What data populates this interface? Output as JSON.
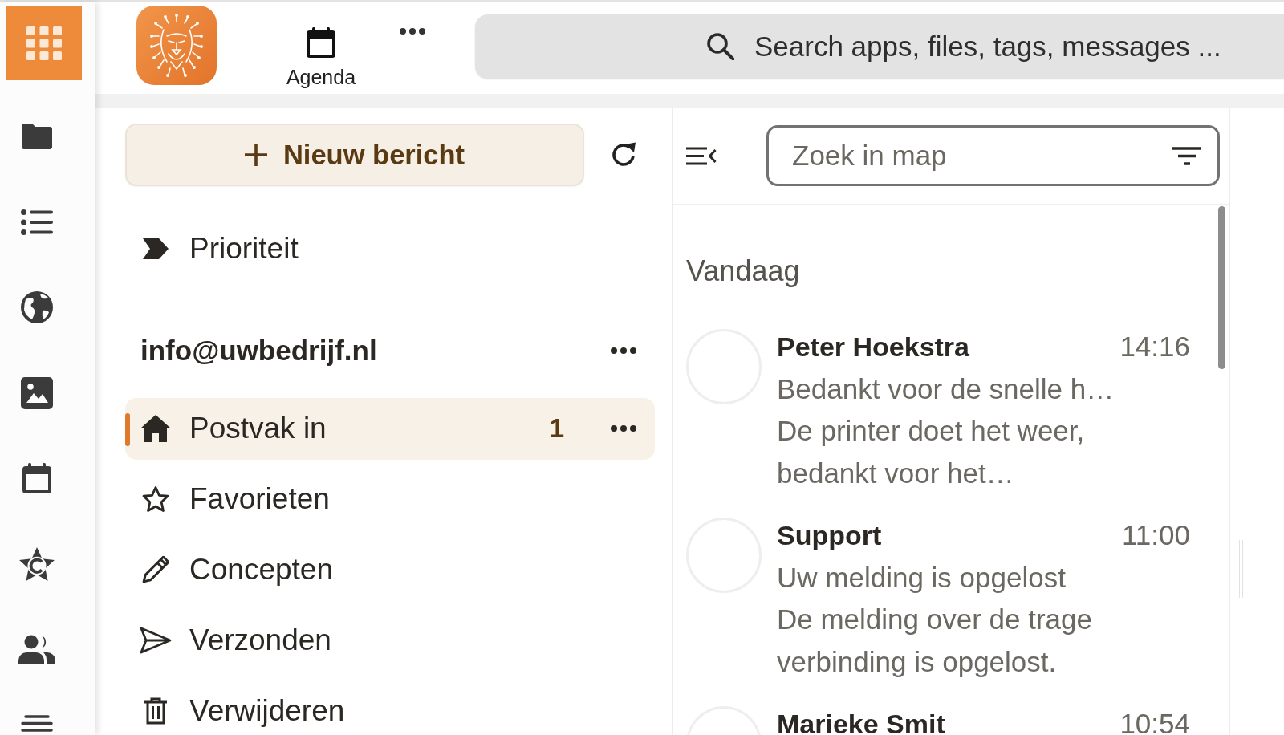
{
  "top_bar": {
    "apps": [
      {
        "label": "Agenda",
        "kind": "calendar"
      }
    ],
    "search": {
      "placeholder": "Search apps, files, tags, messages ..."
    }
  },
  "folder_panel": {
    "new_message_button": "Nieuw bericht",
    "smart_folders": [
      {
        "label": "Prioriteit",
        "kind": "priority",
        "selected": false
      }
    ],
    "account": {
      "email": "info@uwbedrijf.nl",
      "folders": [
        {
          "label": "Postvak in",
          "kind": "inbox",
          "selected": true,
          "unread_count": "1"
        },
        {
          "label": "Favorieten",
          "kind": "starred",
          "selected": false
        },
        {
          "label": "Concepten",
          "kind": "drafts",
          "selected": false
        },
        {
          "label": "Verzonden",
          "kind": "sent",
          "selected": false
        },
        {
          "label": "Verwijderen",
          "kind": "trash",
          "selected": false
        }
      ]
    }
  },
  "message_list": {
    "search": {
      "placeholder": "Zoek in map"
    },
    "groups": [
      {
        "heading": "Vandaag",
        "messages": [
          {
            "sender": "Peter Hoekstra",
            "time": "14:16",
            "subject": "Bedankt voor de snelle h…",
            "preview": "De printer doet het weer, bedankt voor het…"
          },
          {
            "sender": "Support",
            "time": "11:00",
            "subject": "Uw melding is opgelost",
            "preview": "De melding over de trage verbinding is opgelost."
          },
          {
            "sender": "Marieke Smit",
            "time": "10:54"
          }
        ]
      }
    ]
  }
}
